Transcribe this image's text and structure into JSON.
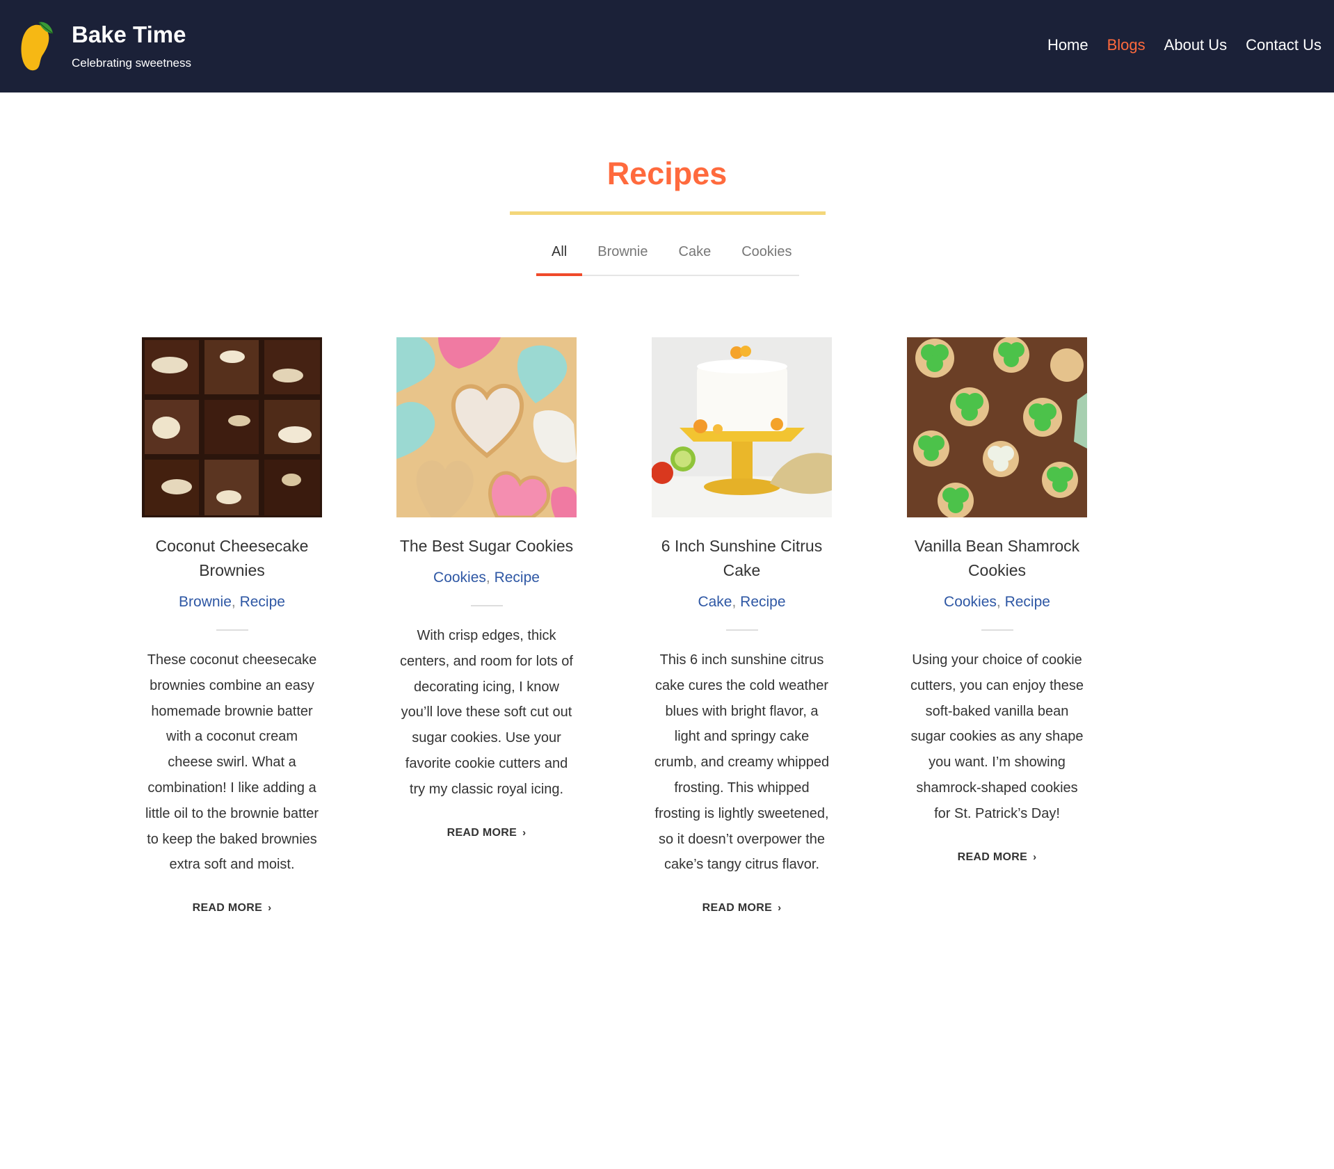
{
  "header": {
    "title": "Bake Time",
    "tagline": "Celebrating sweetness",
    "logo_icon": "mango-logo-icon",
    "colors": {
      "background": "#1b2138",
      "accent": "#ff6a3d"
    }
  },
  "nav": {
    "items": [
      {
        "label": "Home",
        "active": false
      },
      {
        "label": "Blogs",
        "active": true
      },
      {
        "label": "About Us",
        "active": false
      },
      {
        "label": "Contact Us",
        "active": false
      }
    ]
  },
  "main": {
    "title": "Recipes",
    "tabs": [
      {
        "label": "All",
        "active": true
      },
      {
        "label": "Brownie",
        "active": false
      },
      {
        "label": "Cake",
        "active": false
      },
      {
        "label": "Cookies",
        "active": false
      }
    ],
    "cards": [
      {
        "title": "Coconut Cheesecake Brownies",
        "image_icon": "brownie-photo",
        "tags": [
          "Brownie",
          "Recipe"
        ],
        "excerpt": "These coconut cheesecake brownies combine an easy homemade brownie batter with a coconut cream cheese swirl. What a combination! I like adding a little oil to the brownie batter to keep the baked brownies extra soft and moist.",
        "read_more": "READ MORE"
      },
      {
        "title": "The Best Sugar Cookies",
        "image_icon": "heart-cookies-photo",
        "tags": [
          "Cookies",
          "Recipe"
        ],
        "excerpt": "With crisp edges, thick centers, and room for lots of decorating icing, I know you’ll love these soft cut out sugar cookies. Use your favorite cookie cutters and try my classic royal icing.",
        "read_more": "READ MORE"
      },
      {
        "title": "6 Inch Sunshine Citrus Cake",
        "image_icon": "citrus-cake-photo",
        "tags": [
          "Cake",
          "Recipe"
        ],
        "excerpt": "This 6 inch sunshine citrus cake cures the cold weather blues with bright flavor, a light and springy cake crumb, and creamy whipped frosting. This whipped frosting is lightly sweetened, so it doesn’t overpower the cake’s tangy citrus flavor.",
        "read_more": "READ MORE"
      },
      {
        "title": "Vanilla Bean Shamrock Cookies",
        "image_icon": "shamrock-cookies-photo",
        "tags": [
          "Cookies",
          "Recipe"
        ],
        "excerpt": "Using your choice of cookie cutters, you can enjoy these soft-baked vanilla bean sugar cookies as any shape you want. I’m showing shamrock-shaped cookies for St. Patrick’s Day!",
        "read_more": "READ MORE"
      }
    ]
  }
}
